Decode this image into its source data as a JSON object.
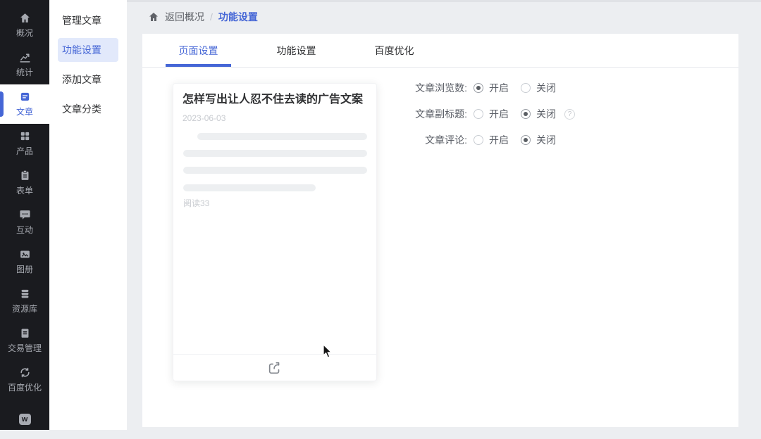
{
  "colors": {
    "accent": "#4566d6",
    "sidebar_bg": "#1a1b1f",
    "page_bg": "#eceef1",
    "active_pill_bg": "#e2e9fb"
  },
  "primary_sidebar": {
    "items": [
      {
        "label": "概况",
        "icon": "home-icon",
        "active": false
      },
      {
        "label": "统计",
        "icon": "stats-icon",
        "active": false
      },
      {
        "label": "文章",
        "icon": "article-icon",
        "active": true
      },
      {
        "label": "产品",
        "icon": "products-grid-icon",
        "active": false
      },
      {
        "label": "表单",
        "icon": "form-icon",
        "active": false
      },
      {
        "label": "互动",
        "icon": "chat-icon",
        "active": false
      },
      {
        "label": "图册",
        "icon": "gallery-icon",
        "active": false
      },
      {
        "label": "资源库",
        "icon": "database-icon",
        "active": false
      },
      {
        "label": "交易管理",
        "icon": "clipboard-icon",
        "active": false
      },
      {
        "label": "百度优化",
        "icon": "sync-icon",
        "active": false
      },
      {
        "label": "w",
        "icon": "w-badge-icon",
        "active": false
      }
    ]
  },
  "secondary_sidebar": {
    "items": [
      {
        "label": "管理文章",
        "active": false
      },
      {
        "label": "功能设置",
        "active": true
      },
      {
        "label": "添加文章",
        "active": false
      },
      {
        "label": "文章分类",
        "active": false
      }
    ]
  },
  "breadcrumb": {
    "back_label": "返回概况",
    "separator": "/",
    "current": "功能设置"
  },
  "tabs": [
    {
      "label": "页面设置",
      "active": true
    },
    {
      "label": "功能设置",
      "active": false
    },
    {
      "label": "百度优化",
      "active": false
    }
  ],
  "preview_card": {
    "title": "怎样写出让人忍不住去读的广告文案",
    "date": "2023-06-03",
    "read_count": "阅读33",
    "share_icon": "share-icon"
  },
  "settings": {
    "rows": [
      {
        "label": "文章浏览数:",
        "options": [
          "开启",
          "关闭"
        ],
        "selected": "开启",
        "help": false
      },
      {
        "label": "文章副标题:",
        "options": [
          "开启",
          "关闭"
        ],
        "selected": "关闭",
        "help": true
      },
      {
        "label": "文章评论:",
        "options": [
          "开启",
          "关闭"
        ],
        "selected": "关闭",
        "help": false
      }
    ],
    "help_glyph": "?"
  }
}
